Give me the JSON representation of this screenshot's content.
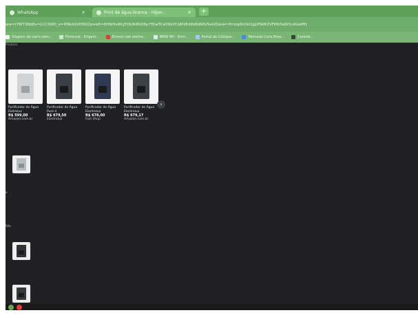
{
  "browser": {
    "tabs": [
      {
        "label": "WhatsApp",
        "active": false
      },
      {
        "label": "Print de água branca - Hiper...",
        "active": true
      }
    ],
    "new_tab_glyph": "+",
    "close_glyph": "×",
    "url": "ww=t7KfT38d8v=1CC5t60_s=4f9k92d0f6D2pvw6=6HW4vWLJFDb9t8hO6p7fEiaTCsOfbGYUJRS8d9b8d66V5eGQskw=Hmzq0hDkOgJ2f9d6ZVFMb5qW5cdGwMIt",
    "bookmarks": [
      {
        "label": "Viagens de carro sem...",
        "color": "#f2f2f2"
      },
      {
        "label": "Pinterest - Engeni...",
        "color": "#c9e6c6"
      },
      {
        "label": "Ensino não assina...",
        "color": "#e53935"
      },
      {
        "label": "BMW Mil - Enm...",
        "color": "#dfe8f7"
      },
      {
        "label": "Portal de Códigos...",
        "color": "#9ec9ff"
      },
      {
        "label": "Mercado Livre Bras...",
        "color": "#4285f4"
      },
      {
        "label": "Central...",
        "color": "#3c4043"
      }
    ]
  },
  "page": {
    "top_label": "Produtos",
    "products": [
      {
        "title": "Purificador de Água Eletrolux",
        "price": "R$ 599,00",
        "store": "Amazon.com.br",
        "color": "#cfd3d6"
      },
      {
        "title": "Purificador de Água Pure 4",
        "price": "R$ 679,50",
        "store": "Electrolux",
        "color": "#3a3f45"
      },
      {
        "title": "Purificador de Água Electrolux",
        "price": "R$ 678,00",
        "store": "Fast Shop",
        "color": "#2f3a52"
      },
      {
        "title": "Purificador de Água Electrolux",
        "price": "R$ 679,17",
        "store": "Amazon.com.br",
        "color": "#3d4247"
      }
    ],
    "next_glyph": "›",
    "side_thumbs": [
      {
        "color": "#b9bec3",
        "label": ""
      },
      {
        "color": "#2f3338",
        "label": "Site"
      },
      {
        "color": "#34393e",
        "label": ""
      }
    ],
    "side_marker_1": "a",
    "side_marker_2": "Site"
  },
  "taskbar": {
    "icons": [
      {
        "name": "chrome-icon",
        "color": "#6aa84f"
      },
      {
        "name": "app-icon",
        "color": "#e53935"
      }
    ]
  }
}
